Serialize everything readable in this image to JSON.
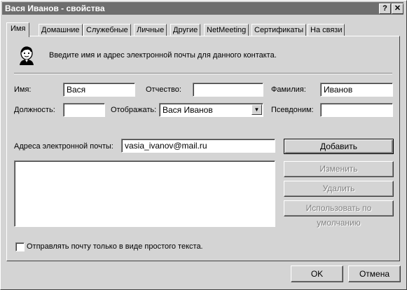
{
  "window": {
    "title": "Вася Иванов - свойства",
    "help_button": "?",
    "close_button": "✕"
  },
  "tabs": [
    {
      "label": "Имя",
      "active": true
    },
    {
      "label": "Домашние"
    },
    {
      "label": "Служебные"
    },
    {
      "label": "Личные"
    },
    {
      "label": "Другие"
    },
    {
      "label": "NetMeeting"
    },
    {
      "label": "Сертификаты"
    },
    {
      "label": "На связи"
    }
  ],
  "intro": {
    "icon": "contact-person-icon",
    "text": "Введите имя и адрес электронной почты для данного контакта."
  },
  "form": {
    "first_name_label": "Имя:",
    "first_name_value": "Вася",
    "middle_name_label": "Отчество:",
    "middle_name_value": "",
    "last_name_label": "Фамилия:",
    "last_name_value": "Иванов",
    "title_label": "Должность:",
    "title_value": "",
    "display_label": "Отображать:",
    "display_value": "Вася Иванов",
    "nickname_label": "Псевдоним:",
    "nickname_value": ""
  },
  "email": {
    "label": "Адреса электронной почты:",
    "value": "vasia_ivanov@mail.ru",
    "add_button": "Добавить",
    "edit_button": "Изменить",
    "delete_button": "Удалить",
    "default_button": "Использовать по умолчанию",
    "plain_text_checkbox": "Отправлять почту только в виде простого текста."
  },
  "footer": {
    "ok_button": "OK",
    "cancel_button": "Отмена"
  },
  "colors": {
    "titlebar": "#6e6e6e",
    "face": "#d4d4d4"
  }
}
